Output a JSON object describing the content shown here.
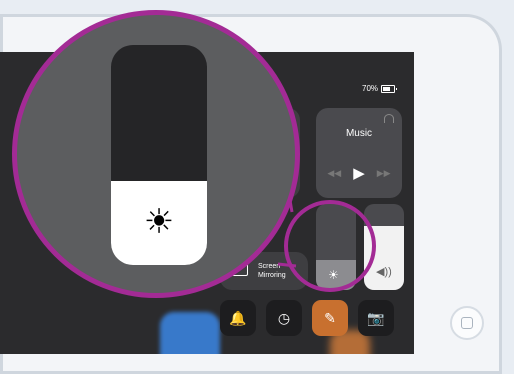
{
  "status_bar": {
    "battery_text": "70%"
  },
  "control_center": {
    "music": {
      "title": "Music",
      "prev_icon": "rewind-icon",
      "play_icon": "play-icon",
      "next_icon": "fast-forward-icon"
    },
    "screen_mirroring": {
      "label": "Screen\nMirroring"
    },
    "brightness": {
      "level": 0.35,
      "icon": "sun-icon"
    },
    "volume": {
      "level": 0.75,
      "icon": "speaker-icon"
    },
    "bottom_buttons": [
      {
        "name": "notifications-button",
        "icon": "bell-icon",
        "glyph": "🔔"
      },
      {
        "name": "timer-button",
        "icon": "timer-icon",
        "glyph": "◷"
      },
      {
        "name": "notes-button",
        "icon": "note-icon",
        "glyph": "✎"
      },
      {
        "name": "camera-button",
        "icon": "camera-icon",
        "glyph": "📷"
      }
    ]
  },
  "magnifier": {
    "brightness_level": 0.38,
    "icon": "sun-icon",
    "glyph": "☀"
  },
  "colors": {
    "accent_ring": "#a32b95",
    "active_button": "#c8702f"
  }
}
